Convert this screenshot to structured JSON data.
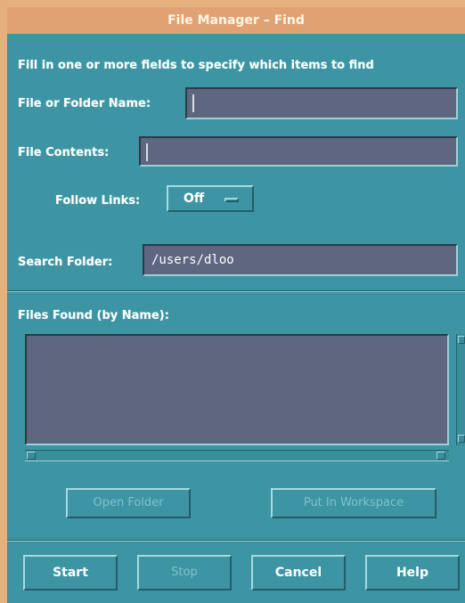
{
  "window": {
    "title": "File Manager – Find"
  },
  "instructions": "Fill in one or more fields to specify which items to find",
  "name_field": {
    "label": "File or Folder Name:",
    "value": ""
  },
  "contents_field": {
    "label": "File Contents:",
    "value": ""
  },
  "follow_links": {
    "label": "Follow Links:",
    "value": "Off"
  },
  "search_folder": {
    "label": "Search Folder:",
    "value": "/users/dloo"
  },
  "results": {
    "label": "Files Found (by Name):",
    "items": []
  },
  "result_actions": {
    "open_folder": "Open Folder",
    "put_in_workspace": "Put In Workspace"
  },
  "buttons": {
    "start": "Start",
    "stop": "Stop",
    "cancel": "Cancel",
    "help": "Help"
  },
  "colors": {
    "window_bg": "#3d95a4",
    "field_bg": "#5f6680",
    "titlebar": "#e0a272"
  }
}
